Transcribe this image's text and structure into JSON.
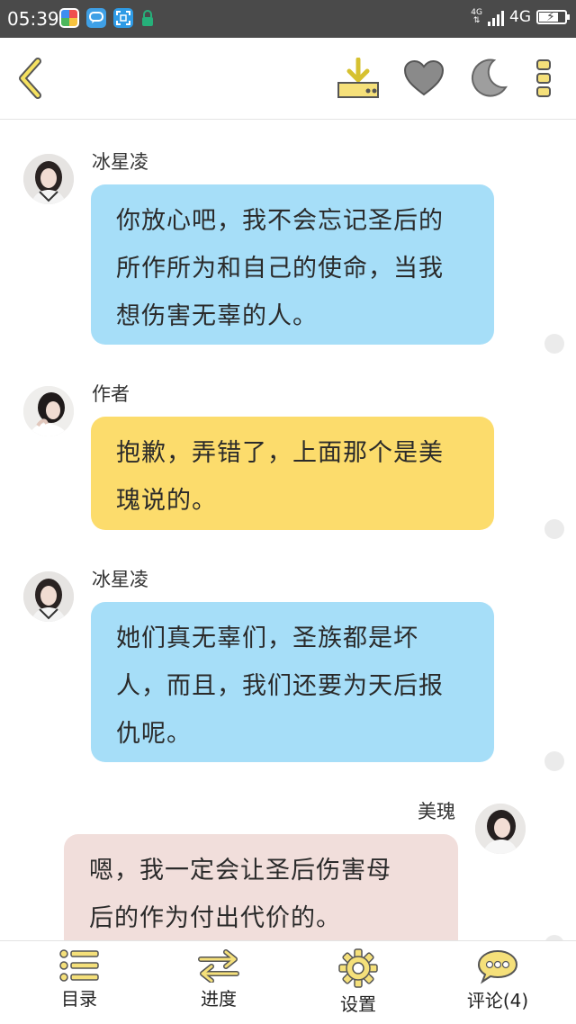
{
  "status_bar": {
    "time": "05:39",
    "network_small": "4G",
    "network": "4G",
    "battery_level": 0.7
  },
  "toolbar": {
    "back_icon": "chevron-left-icon",
    "download_icon": "download-icon",
    "favorite_icon": "heart-icon",
    "night_mode_icon": "moon-icon",
    "more_icon": "more-vertical-icon"
  },
  "colors": {
    "accent": "#c8b400",
    "bubble_blue": "#a6def8",
    "bubble_yellow": "#fcdc6c",
    "bubble_pink": "#f1dedb"
  },
  "messages": [
    {
      "sender": "冰星凌",
      "side": "left",
      "color": "blue",
      "lines": [
        "你放心吧，我不会忘记圣后的",
        "所作所为和自己的使命，当我",
        "想伤害无辜的人。"
      ]
    },
    {
      "sender": "作者",
      "side": "left",
      "color": "yellow",
      "lines": [
        "抱歉，弄错了，上面那个是美",
        "瑰说的。"
      ]
    },
    {
      "sender": "冰星凌",
      "side": "left",
      "color": "blue",
      "lines": [
        "她们真无辜们，圣族都是坏",
        "人，而且，我们还要为天后报",
        "仇呢。"
      ]
    },
    {
      "sender": "美瑰",
      "side": "right",
      "color": "pink",
      "lines": [
        "嗯，我一定会让圣后伤害母",
        "后的作为付出代价的。"
      ]
    }
  ],
  "bottom_nav": [
    {
      "label": "目录",
      "icon": "list-icon"
    },
    {
      "label": "进度",
      "icon": "swap-arrows-icon"
    },
    {
      "label": "设置",
      "icon": "gear-icon"
    },
    {
      "label": "评论(4)",
      "icon": "comment-bubble-icon"
    }
  ]
}
